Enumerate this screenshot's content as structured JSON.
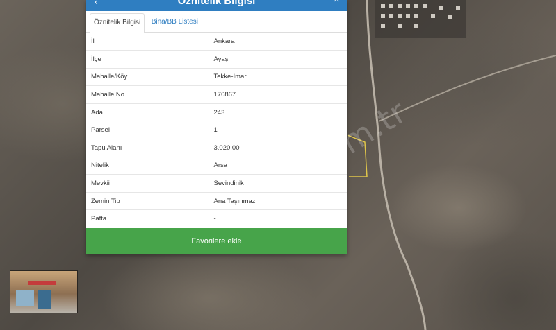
{
  "panel": {
    "title": "Öznitelik Bilgisi",
    "tabs": [
      {
        "label": "Öznitelik Bilgisi",
        "active": true
      },
      {
        "label": "Bina/BB Listesi",
        "active": false
      }
    ],
    "rows": [
      {
        "key": "İl",
        "value": "Ankara"
      },
      {
        "key": "İlçe",
        "value": "Ayaş"
      },
      {
        "key": "Mahalle/Köy",
        "value": "Tekke-İmar"
      },
      {
        "key": "Mahalle No",
        "value": "170867"
      },
      {
        "key": "Ada",
        "value": "243"
      },
      {
        "key": "Parsel",
        "value": "1"
      },
      {
        "key": "Tapu Alanı",
        "value": "3.020,00"
      },
      {
        "key": "Nitelik",
        "value": "Arsa"
      },
      {
        "key": "Mevkii",
        "value": "Sevindinik"
      },
      {
        "key": "Zemin Tip",
        "value": "Ana Taşınmaz"
      },
      {
        "key": "Pafta",
        "value": "-"
      }
    ],
    "favorite_button": "Favorilere ekle"
  },
  "watermark": "emlakjet.com.tr",
  "colors": {
    "header": "#2f7ec1",
    "button": "#47a44a",
    "tab_link": "#2f7ec1"
  }
}
